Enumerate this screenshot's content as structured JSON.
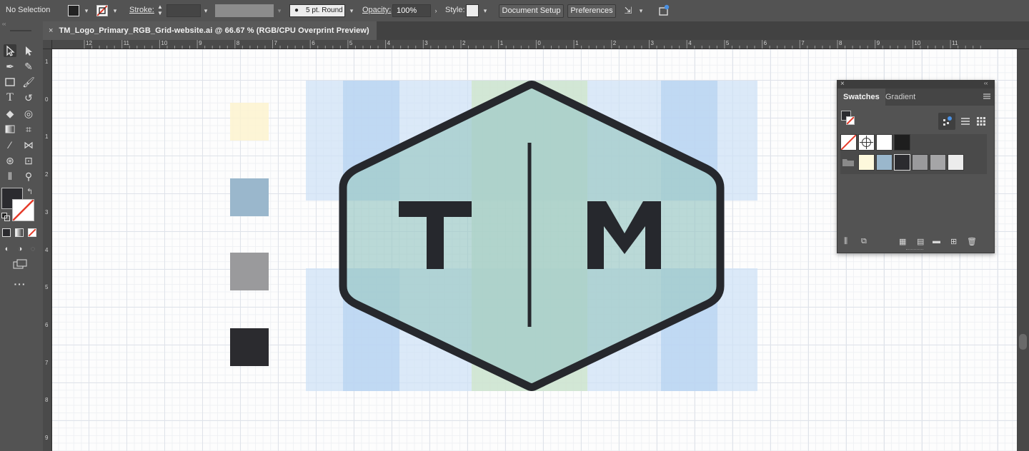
{
  "controlbar": {
    "selection_label": "No Selection",
    "stroke_label": "Stroke:",
    "stroke_weight": "",
    "brush_label": "5 pt. Round",
    "opacity_label": "Opacity:",
    "opacity_value": "100%",
    "style_label": "Style:",
    "document_setup_label": "Document Setup",
    "preferences_label": "Preferences"
  },
  "document": {
    "tab_title": "TM_Logo_Primary_RGB_Grid-website.ai @ 66.67 % (RGB/CPU Overprint Preview)",
    "close_glyph": "×"
  },
  "rulers": {
    "top": [
      "12",
      "11",
      "10",
      "9",
      "8",
      "7",
      "6",
      "5",
      "4",
      "3",
      "2",
      "1",
      "0",
      "1",
      "2",
      "3",
      "4",
      "5",
      "6",
      "7",
      "8",
      "9",
      "10",
      "11"
    ],
    "left": [
      "1",
      "0",
      "1",
      "2",
      "3",
      "4",
      "5",
      "6",
      "7",
      "8",
      "9"
    ]
  },
  "logo": {
    "letter_left": "T",
    "letter_right": "M"
  },
  "colors": {
    "yellow": "#fdf3cf",
    "blue_gray": "#9ab7cc",
    "gray": "#9a9a9c",
    "dark": "#2b2b2f",
    "hex_fill": "#b3d6d2",
    "hex_stroke": "#26282d"
  },
  "panel": {
    "tab_swatches": "Swatches",
    "tab_gradient": "Gradient",
    "menu_icon": "hamburger-icon"
  },
  "icons": {
    "selection": "selection-arrow-icon",
    "direct_selection": "direct-selection-icon",
    "pen": "pen-icon",
    "type": "type-icon",
    "zoom": "zoom-icon"
  }
}
